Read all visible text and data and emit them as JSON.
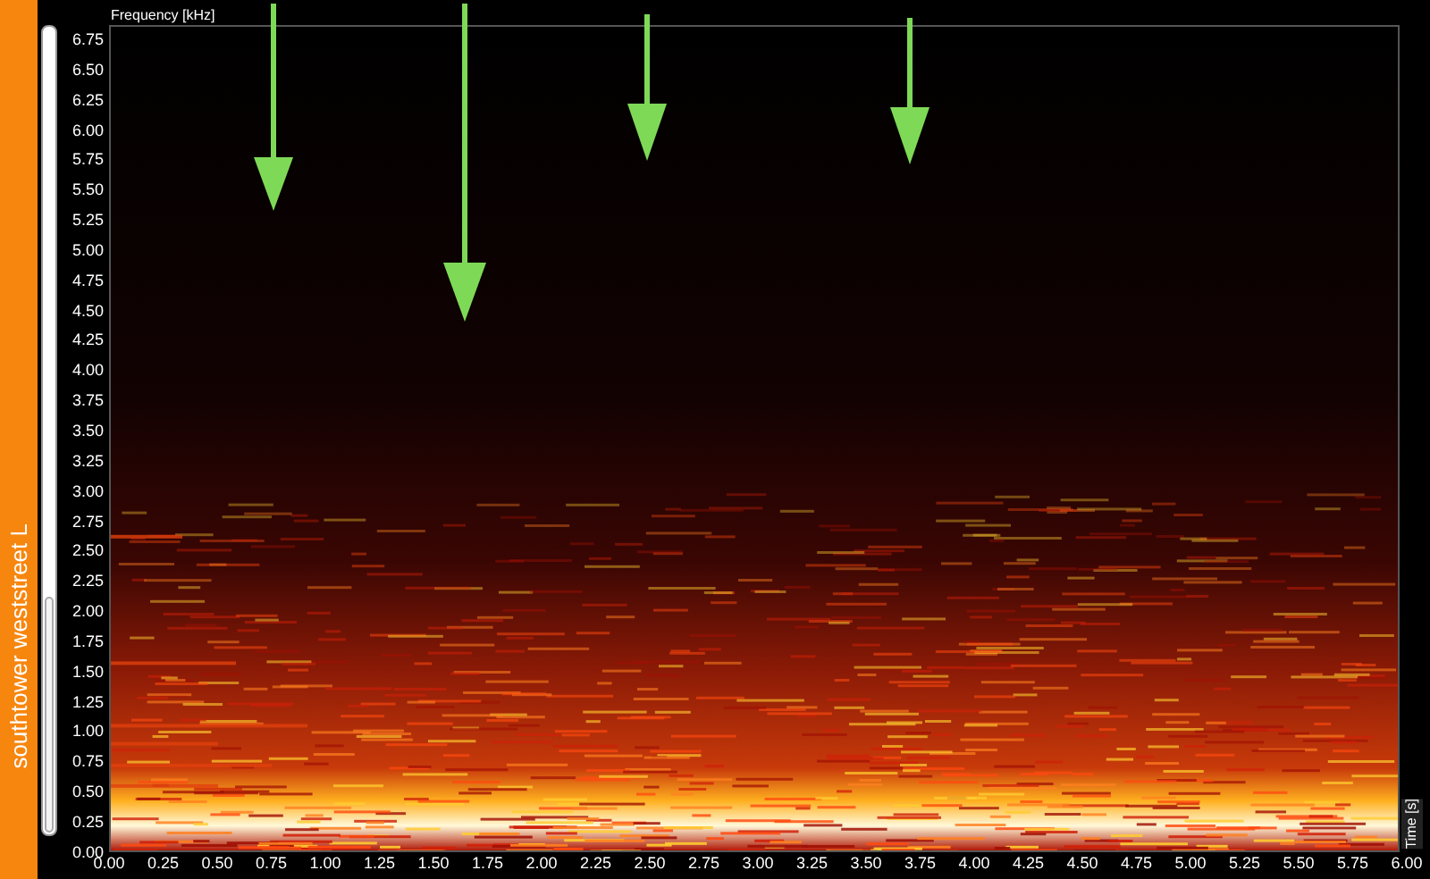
{
  "sidebar": {
    "title": "southtower weststreet L"
  },
  "plot": {
    "y_axis": {
      "title": "Frequency [kHz]",
      "ticks": [
        "6.75",
        "6.50",
        "6.25",
        "6.00",
        "5.75",
        "5.50",
        "5.25",
        "5.00",
        "4.75",
        "4.50",
        "4.25",
        "4.00",
        "3.75",
        "3.50",
        "3.25",
        "3.00",
        "2.75",
        "2.50",
        "2.25",
        "2.00",
        "1.75",
        "1.50",
        "1.25",
        "1.00",
        "0.75",
        "0.50",
        "0.25",
        "0.00"
      ]
    },
    "x_axis": {
      "title": "Time [s]",
      "ticks": [
        "0.00",
        "0.25",
        "0.50",
        "0.75",
        "1.00",
        "1.25",
        "1.50",
        "1.75",
        "2.00",
        "2.25",
        "2.50",
        "2.75",
        "3.00",
        "3.25",
        "3.50",
        "3.75",
        "4.00",
        "4.25",
        "4.50",
        "4.75",
        "5.00",
        "5.25",
        "5.50",
        "5.75",
        "6.00"
      ]
    }
  }
}
